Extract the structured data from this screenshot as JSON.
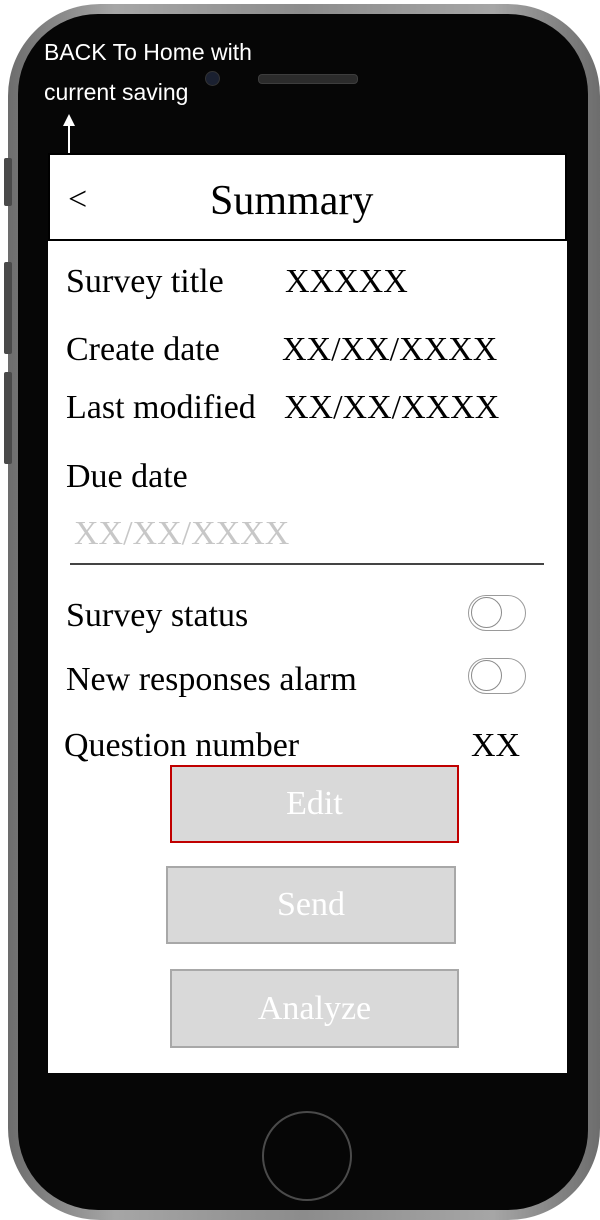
{
  "annotation": {
    "text": "BACK To Home with\ncurrent saving"
  },
  "header": {
    "back_label": "<",
    "title": "Summary"
  },
  "fields": {
    "survey_title": {
      "label": "Survey title",
      "value": "XXXXX"
    },
    "create_date": {
      "label": "Create date",
      "value": "XX/XX/XXXX"
    },
    "last_modified": {
      "label": "Last modified",
      "value": "XX/XX/XXXX"
    },
    "due_date": {
      "label": "Due date",
      "value": "XX/XX/XXXX"
    },
    "survey_status": {
      "label": "Survey status",
      "on": false
    },
    "new_responses_alarm": {
      "label": "New responses alarm",
      "on": false
    },
    "question_number": {
      "label": "Question number",
      "value": "XX"
    }
  },
  "buttons": {
    "edit": "Edit",
    "send": "Send",
    "analyze": "Analyze"
  },
  "colors": {
    "button_fill": "#d9d9d9",
    "edit_border": "#c00000",
    "phone_body": "#060606"
  }
}
